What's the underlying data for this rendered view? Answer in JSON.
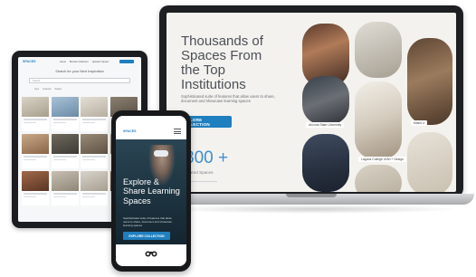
{
  "laptop": {
    "hero_title": "Thousands of Spaces From the Top Institutions",
    "hero_description": "Sophisticated suite of features that allow users to share, document and showcase learning spaces",
    "cta_label": "EXPLORE COLLECTION",
    "stat_value": "800 +",
    "stat_label": "Shared Spaces",
    "tiles": [
      {
        "label": "Arizona State University"
      },
      {
        "label": "Laguna College of Art + Design"
      },
      {
        "label": "Miami U"
      }
    ]
  },
  "tablet": {
    "brand": "SPACES",
    "nav_items": [
      "Home",
      "Browse Collection",
      "Upload a Space"
    ],
    "heading": "Search for your Next Inspiration",
    "search_placeholder": "Search",
    "filters": [
      "Type",
      "Features",
      "Region"
    ]
  },
  "phone": {
    "brand": "SPACES",
    "hero_title": "Explore & Share Learning Spaces",
    "hero_description": "Sophisticated suite of features that allow users to share, document and showcase learning spaces",
    "cta_label": "EXPLORE COLLECTION"
  },
  "colors": {
    "accent": "#1f7fbf",
    "stat": "#3d8ed0",
    "device_frame": "#1c1d20"
  }
}
